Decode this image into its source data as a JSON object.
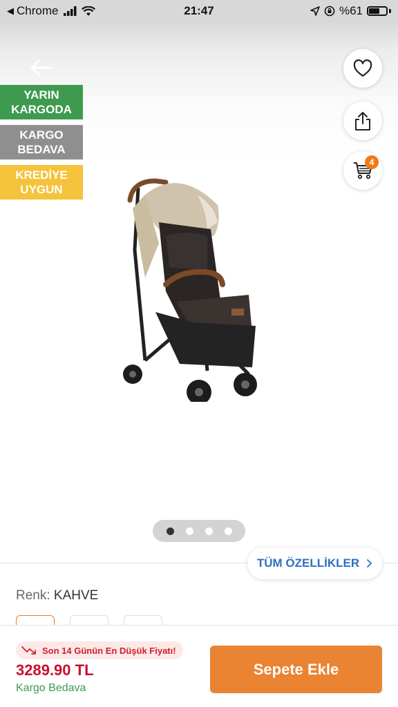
{
  "status_bar": {
    "back_app": "Chrome",
    "time": "21:47",
    "battery_label": "%61",
    "battery_level": 0.61
  },
  "hero": {
    "tags": [
      {
        "label": "YARIN KARGODA",
        "color": "#3d9a4e"
      },
      {
        "label": "KARGO BEDAVA",
        "color": "#8f8f8f"
      },
      {
        "label": "KREDİYE UYGUN",
        "color": "#f5c33b"
      }
    ],
    "cart_count": "4",
    "icons": {
      "back": "arrow-left-icon",
      "favorite": "heart-icon",
      "share": "share-icon",
      "cart": "cart-icon"
    },
    "carousel": {
      "total": 4,
      "active": 1
    }
  },
  "specs_button": {
    "label": "TÜM ÖZELLİKLER"
  },
  "color": {
    "label": "Renk:",
    "value": "KAHVE"
  },
  "bottom_bar": {
    "lowest_price_note": "Son 14 Günün En Düşük Fiyatı!",
    "price": "3289.90 TL",
    "shipping": "Kargo Bedava",
    "add_to_cart": "Sepete Ekle"
  },
  "colors": {
    "accent": "#ea8332",
    "price_red": "#c8102e",
    "link_blue": "#2f6fbd",
    "green": "#3d9a4e"
  }
}
